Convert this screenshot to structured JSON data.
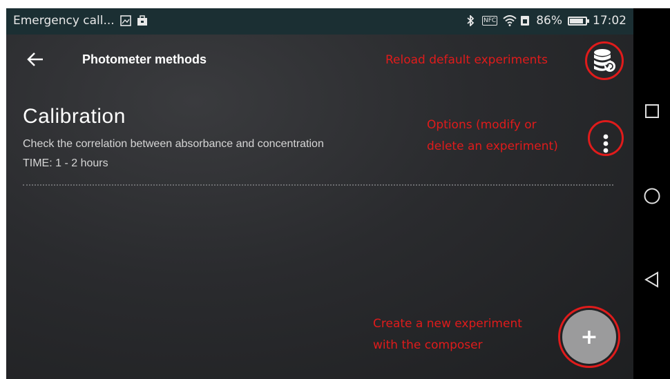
{
  "status_bar": {
    "notification_text": "Emergency call...",
    "icons_left": [
      "image-icon",
      "briefcase-icon"
    ],
    "icons_right": [
      "bluetooth-icon",
      "nfc-icon",
      "wifi-icon",
      "sim-icon",
      "battery-icon"
    ],
    "nfc_label": "NFC",
    "battery_percent": "86%",
    "battery_level": 0.86,
    "time": "17:02"
  },
  "app_bar": {
    "title": "Photometer methods"
  },
  "experiments": [
    {
      "name": "Calibration",
      "description": "Check the correlation between absorbance and concentration",
      "time": "TIME: 1 - 2 hours"
    }
  ],
  "annotations": {
    "reload": "Reload default experiments",
    "options_line1": "Options (modify or",
    "options_line2": "delete an experiment)",
    "create_line1": "Create a new experiment",
    "create_line2": "with the composer",
    "color": "#e01b1b"
  },
  "fab": {
    "label": "+"
  },
  "nav_bar": {
    "buttons": [
      "recents-square-icon",
      "home-circle-icon",
      "back-triangle-icon"
    ]
  },
  "colors": {
    "status_bar_bg": "#1b2f33",
    "screen_bg": "#2a2b2e",
    "fab_bg": "#9b9b9c",
    "annotation_red": "#e01b1b"
  }
}
